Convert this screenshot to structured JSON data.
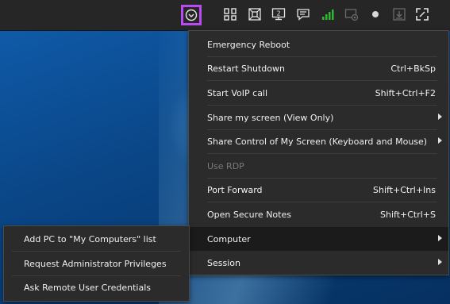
{
  "toolbar": {
    "icons": [
      {
        "name": "options-chevron-icon"
      },
      {
        "name": "view-layout-icon"
      },
      {
        "name": "fit-screen-icon"
      },
      {
        "name": "monitor-select-icon",
        "badge": "2"
      },
      {
        "name": "chat-icon"
      },
      {
        "name": "connection-quality-icon",
        "color": "#2fb830"
      },
      {
        "name": "screen-record-icon"
      },
      {
        "name": "record-dot-icon"
      },
      {
        "name": "file-transfer-icon"
      },
      {
        "name": "fullscreen-icon"
      }
    ]
  },
  "main_menu": {
    "items": [
      {
        "label": "Emergency Reboot",
        "shortcut": ""
      },
      {
        "label": "Restart  Shutdown",
        "shortcut": "Ctrl+BkSp"
      },
      {
        "label": "Start VoIP call",
        "shortcut": "Shift+Ctrl+F2"
      },
      {
        "label": "Share my screen (View Only)",
        "shortcut": "",
        "submenu": true
      },
      {
        "label": "Share Control of My Screen (Keyboard and Mouse)",
        "shortcut": "",
        "submenu": true
      },
      {
        "label": "Use RDP",
        "shortcut": "",
        "disabled": true
      },
      {
        "label": "Port Forward",
        "shortcut": "Shift+Ctrl+Ins"
      },
      {
        "label": "Open Secure Notes",
        "shortcut": "Shift+Ctrl+S"
      },
      {
        "label": "Computer",
        "shortcut": "",
        "submenu": true,
        "active": true
      },
      {
        "label": "Session",
        "shortcut": "",
        "submenu": true
      }
    ]
  },
  "computer_submenu": {
    "items": [
      {
        "label": "Add PC to \"My Computers\" list"
      },
      {
        "label": "Request Administrator Privileges"
      },
      {
        "label": "Ask Remote User Credentials"
      }
    ]
  },
  "colors": {
    "toolbar_bg": "#262626",
    "menu_bg": "#2b2b2b",
    "highlight_border": "#b84cf0",
    "signal_green": "#2fb830"
  }
}
